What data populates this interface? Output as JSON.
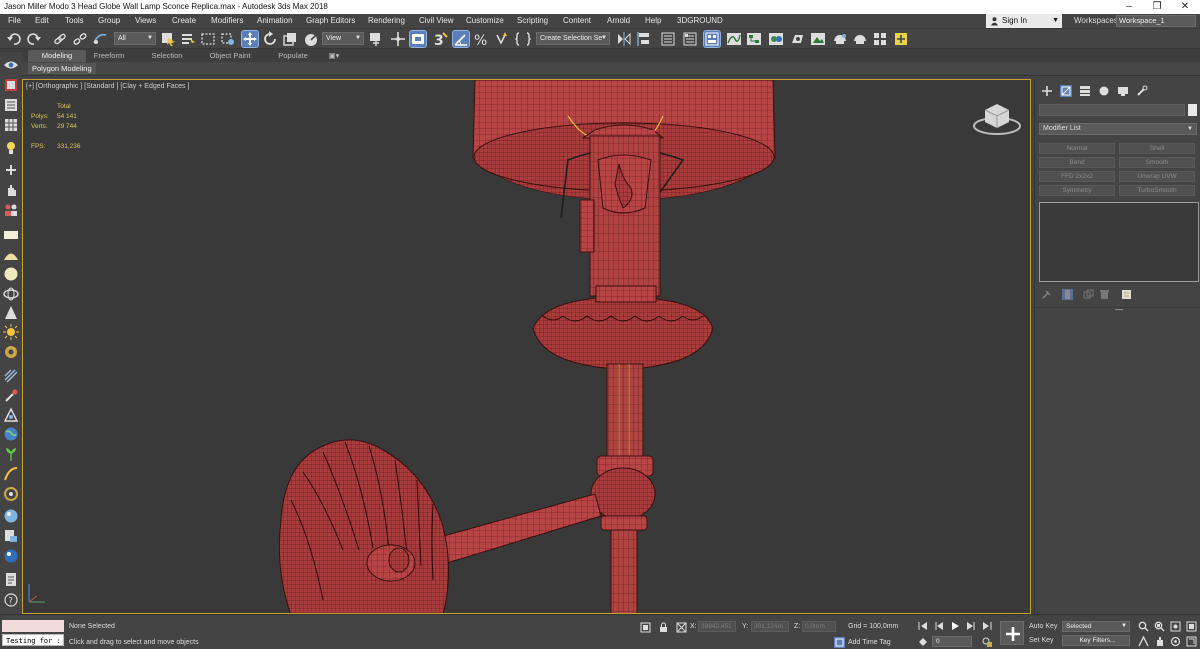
{
  "window": {
    "title": "Jason Miller Modo 3 Head Globe Wall Lamp Sconce Replica.max - Autodesk 3ds Max 2018",
    "controls": [
      "–",
      "❐",
      "✕"
    ]
  },
  "menu": [
    "File",
    "Edit",
    "Tools",
    "Group",
    "Views",
    "Create",
    "Modifiers",
    "Animation",
    "Graph Editors",
    "Rendering",
    "Civil View",
    "Customize",
    "Scripting",
    "Content",
    "Arnold",
    "Help",
    "3DGROUND"
  ],
  "account": {
    "sign_in": "Sign In",
    "workspaces_label": "Workspaces:",
    "workspace": "Workspace_1"
  },
  "toolbar": {
    "selection_filter": "All",
    "reference_coord": "View",
    "selection_set": "Create Selection Se"
  },
  "ribbon": {
    "tabs": [
      "Modeling",
      "Freeform",
      "Selection",
      "Object Paint",
      "Populate"
    ],
    "active_tab": "Modeling",
    "panel_label": "Polygon Modeling"
  },
  "viewport": {
    "label": "[+] [Orthographic ] [Standard ] [Clay + Edged Faces ]",
    "stats": {
      "total_label": "Total",
      "polys_label": "Polys:",
      "polys": "54 141",
      "verts_label": "Verts:",
      "verts": "29 744",
      "fps_label": "FPS:",
      "fps": "331,236"
    }
  },
  "command_panel": {
    "modifier_list": "Modifier List",
    "modifier_buttons": [
      "Normal",
      "Shell",
      "Bend",
      "Smooth",
      "FFD 2x2x2",
      "Unwrap UVW",
      "Symmetry",
      "TurboSmooth"
    ]
  },
  "status": {
    "maxscript_input": "Testing for :",
    "selection": "None Selected",
    "prompt": "Click and drag to select and move objects",
    "x_label": "X:",
    "x_value": "39942,451",
    "y_label": "Y:",
    "y_value": "301,124m",
    "z_label": "Z:",
    "z_value": "0,0mm",
    "grid": "Grid = 100,0mm",
    "add_time_tag": "Add Time Tag",
    "frame": "0",
    "auto_key": "Auto Key",
    "set_key": "Set Key",
    "key_mode": "Selected",
    "key_filters": "Key Filters..."
  }
}
